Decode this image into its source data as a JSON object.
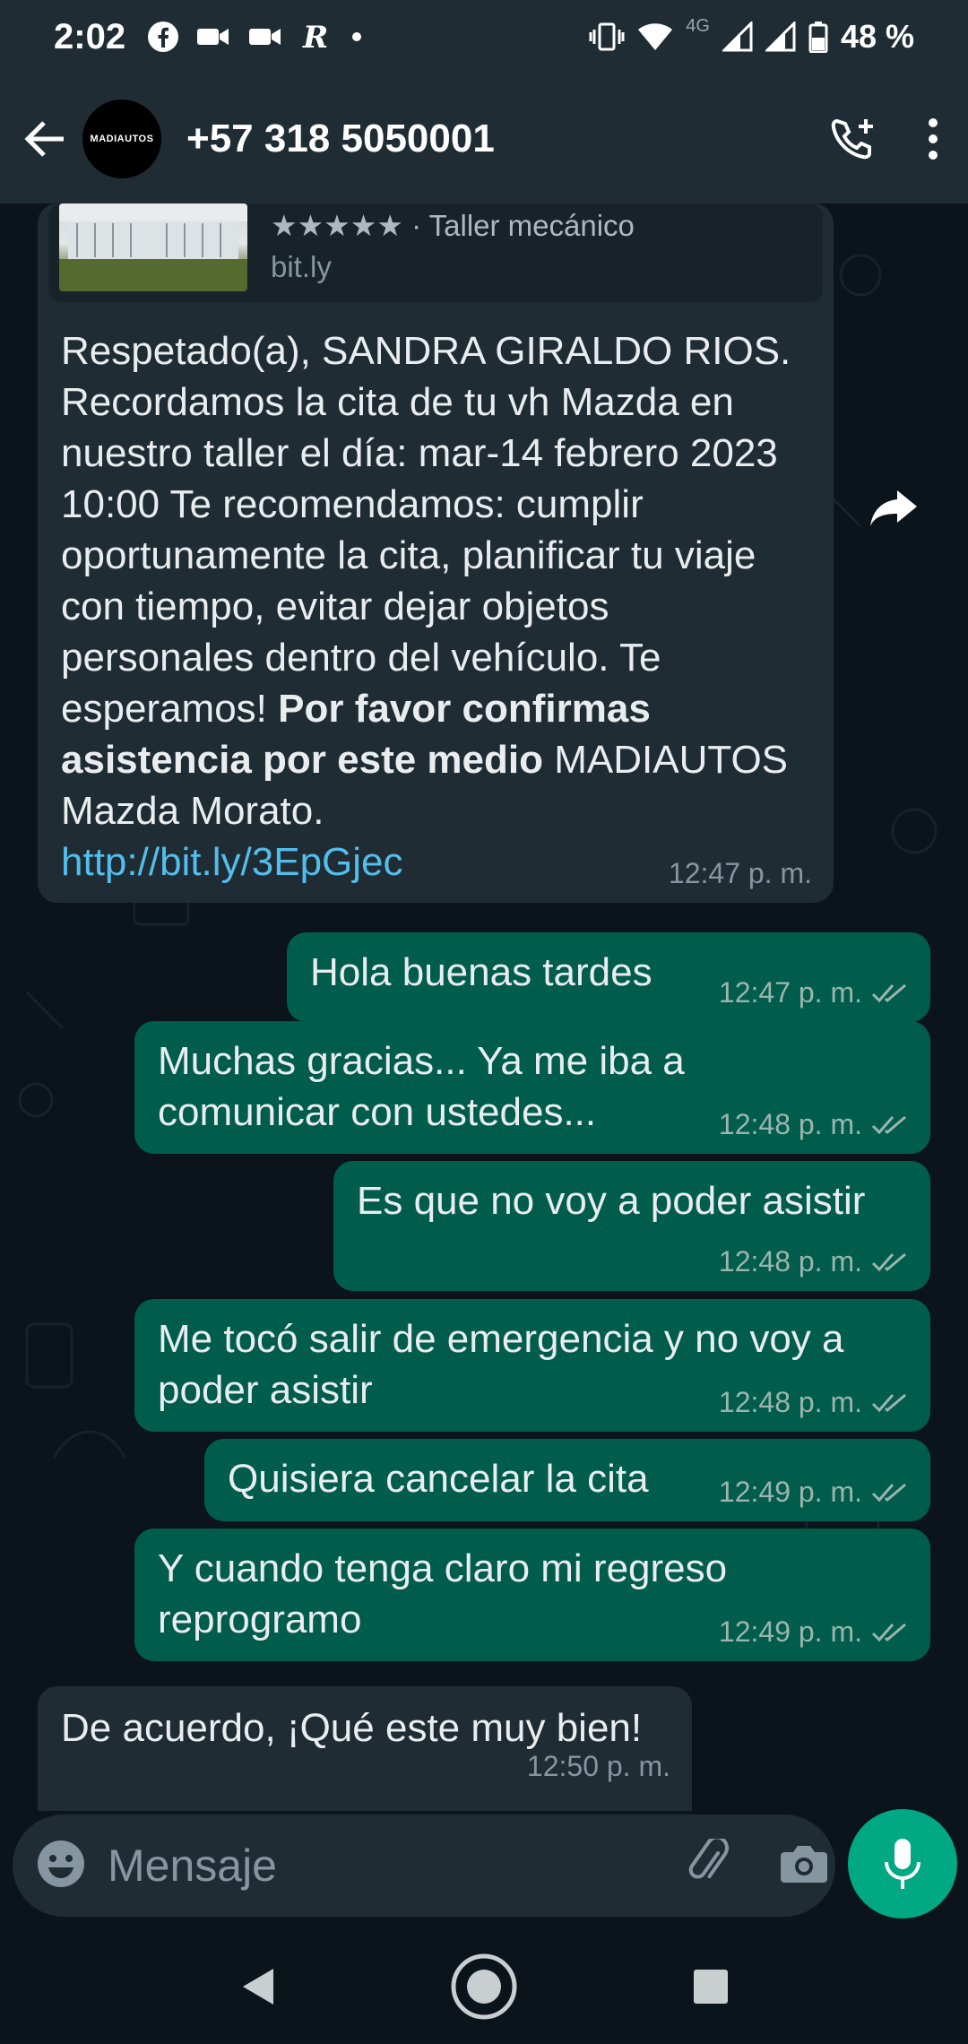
{
  "status_bar": {
    "time": "2:02",
    "notification_icons": [
      "facebook-icon",
      "video-call-icon",
      "video-call-icon",
      "r-app-icon",
      "dot-icon"
    ],
    "network_label": "4G",
    "battery": "48 %"
  },
  "header": {
    "avatar_text": "MADIAUTOS",
    "contact_name": "+57 318 5050001"
  },
  "messages": [
    {
      "direction": "in",
      "preview": {
        "title": "★★★★★ · Taller mecánico",
        "domain": "bit.ly"
      },
      "text_1": "Respetado(a), SANDRA GIRALDO RIOS. Recordamos la cita de tu vh Mazda en nuestro taller el día: mar-14 febrero 2023 10:00 Te recomendamos: cumplir oportunamente la cita, planificar tu viaje con tiempo, evitar dejar objetos personales dentro del vehículo. Te esperamos!",
      "text_bold": "Por favor confirmas asistencia por este medio",
      "text_2": "MADIAUTOS Mazda Morato.",
      "link": "http://bit.ly/3EpGjec",
      "time": "12:47 p. m."
    },
    {
      "direction": "out",
      "text": "Hola buenas tardes",
      "time": "12:47 p. m."
    },
    {
      "direction": "out",
      "text": "Muchas gracias... Ya me iba a comunicar con ustedes...",
      "time": "12:48 p. m."
    },
    {
      "direction": "out",
      "text": "Es que no voy a poder asistir",
      "time": "12:48 p. m."
    },
    {
      "direction": "out",
      "text": "Me tocó salir de emergencia y no voy a poder asistir",
      "time": "12:48 p. m."
    },
    {
      "direction": "out",
      "text": "Quisiera cancelar la cita",
      "time": "12:49 p. m."
    },
    {
      "direction": "out",
      "text": "Y cuando tenga claro mi regreso reprogramo",
      "time": "12:49 p. m."
    },
    {
      "direction": "in",
      "text": "De acuerdo, ¡Qué este muy bien!",
      "time": "12:50 p. m."
    }
  ],
  "composer": {
    "placeholder": "Mensaje"
  },
  "colors": {
    "header_bg": "#1f2c34",
    "chat_bg": "#0b141a",
    "incoming_bubble": "#1f2c34",
    "outgoing_bubble": "#005c4b",
    "accent": "#00a884",
    "link": "#53bdeb"
  }
}
